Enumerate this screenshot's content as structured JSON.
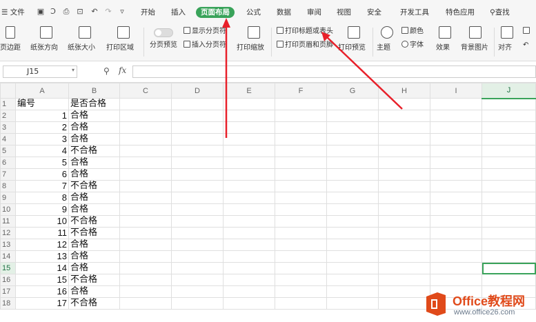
{
  "menubar": {
    "file_label": "文件",
    "tabs": [
      "开始",
      "插入",
      "页面布局",
      "公式",
      "数据",
      "审阅",
      "视图",
      "安全",
      "开发工具",
      "特色应用"
    ],
    "active_tab": "页面布局",
    "search_label": "查找"
  },
  "ribbon": {
    "margins": "页边距",
    "orientation": "纸张方向",
    "size": "纸张大小",
    "print_area": "打印区域",
    "page_break_preview": "分页预览",
    "show_page_breaks": "显示分页符",
    "insert_page_break": "插入分页符",
    "print_scaling": "打印缩放",
    "print_titles": "打印标题或表头",
    "print_header_footer": "打印页眉和页脚",
    "print_preview": "打印预览",
    "theme": "主题",
    "colors": "颜色",
    "fonts": "字体",
    "effects": "效果",
    "background": "背景图片",
    "align": "对齐"
  },
  "formula_bar": {
    "name_box": "J15",
    "fx_label": "fx",
    "value": ""
  },
  "sheet": {
    "columns": [
      "A",
      "B",
      "C",
      "D",
      "E",
      "F",
      "G",
      "H",
      "I",
      "J"
    ],
    "active_cell": "J15",
    "rows": [
      {
        "n": "1",
        "a": "编号",
        "b": "是否合格"
      },
      {
        "n": "2",
        "a": "1",
        "b": "合格"
      },
      {
        "n": "3",
        "a": "2",
        "b": "合格"
      },
      {
        "n": "4",
        "a": "3",
        "b": "合格"
      },
      {
        "n": "5",
        "a": "4",
        "b": "不合格"
      },
      {
        "n": "6",
        "a": "5",
        "b": "合格"
      },
      {
        "n": "7",
        "a": "6",
        "b": "合格"
      },
      {
        "n": "8",
        "a": "7",
        "b": "不合格"
      },
      {
        "n": "9",
        "a": "8",
        "b": "合格"
      },
      {
        "n": "10",
        "a": "9",
        "b": "合格"
      },
      {
        "n": "11",
        "a": "10",
        "b": "不合格"
      },
      {
        "n": "12",
        "a": "11",
        "b": "不合格"
      },
      {
        "n": "13",
        "a": "12",
        "b": "合格"
      },
      {
        "n": "14",
        "a": "13",
        "b": "合格"
      },
      {
        "n": "15",
        "a": "14",
        "b": "合格"
      },
      {
        "n": "16",
        "a": "15",
        "b": "不合格"
      },
      {
        "n": "17",
        "a": "16",
        "b": "合格"
      },
      {
        "n": "18",
        "a": "17",
        "b": "不合格"
      }
    ]
  },
  "watermark": {
    "title": "Office教程网",
    "url": "www.office26.com"
  },
  "colors": {
    "accent_green": "#39a35a",
    "arrow_red": "#e8202a",
    "watermark_orange": "#e04a1a"
  }
}
